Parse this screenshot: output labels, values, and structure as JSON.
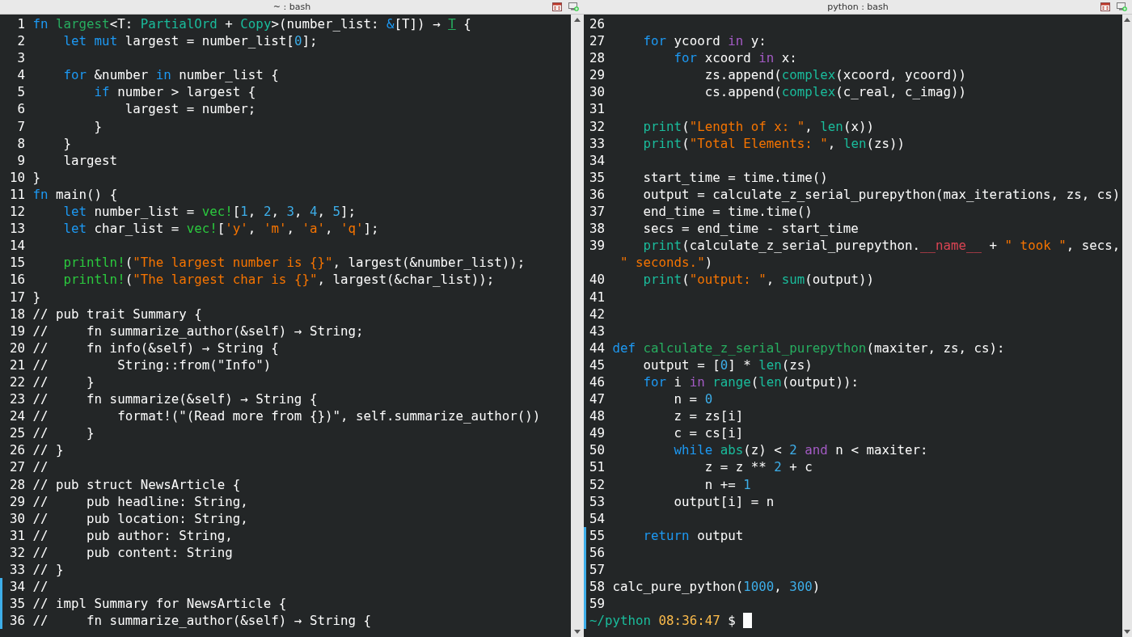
{
  "panes": [
    {
      "title": "~ : bash",
      "lines": [
        {
          "number": "1",
          "marked": false,
          "tokens": [
            {
              "text": "fn",
              "kind": "keyword"
            },
            {
              "text": " largest",
              "kind": "function"
            },
            {
              "text": "<T: ",
              "kind": "plain"
            },
            {
              "text": "PartialOrd",
              "kind": "type"
            },
            {
              "text": " + ",
              "kind": "plain"
            },
            {
              "text": "Copy",
              "kind": "type"
            },
            {
              "text": ">(number_list: ",
              "kind": "plain"
            },
            {
              "text": "&",
              "kind": "keyword"
            },
            {
              "text": "[T]) → ",
              "kind": "plain"
            },
            {
              "text": "T",
              "kind": "return"
            },
            {
              "text": " {",
              "kind": "plain"
            }
          ]
        },
        {
          "number": "2",
          "marked": false,
          "tokens": [
            {
              "text": "    let",
              "kind": "keyword"
            },
            {
              "text": " mut",
              "kind": "keyword"
            },
            {
              "text": " largest = number_list[",
              "kind": "plain"
            },
            {
              "text": "0",
              "kind": "number"
            },
            {
              "text": "];",
              "kind": "plain"
            }
          ]
        },
        {
          "number": "3",
          "marked": false
        },
        {
          "number": "4",
          "marked": false,
          "tokens": [
            {
              "text": "    for",
              "kind": "keyword"
            },
            {
              "text": " &number ",
              "kind": "plain"
            },
            {
              "text": "in",
              "kind": "keyword"
            },
            {
              "text": " number_list {",
              "kind": "plain"
            }
          ]
        },
        {
          "number": "5",
          "marked": false,
          "tokens": [
            {
              "text": "        if",
              "kind": "keyword"
            },
            {
              "text": " number > largest {",
              "kind": "plain"
            }
          ]
        },
        {
          "number": "6",
          "marked": false,
          "tokens": [
            {
              "text": "            largest = number;",
              "kind": "plain"
            }
          ]
        },
        {
          "number": "7",
          "marked": false,
          "tokens": [
            {
              "text": "        }",
              "kind": "plain"
            }
          ]
        },
        {
          "number": "8",
          "marked": false,
          "tokens": [
            {
              "text": "    }",
              "kind": "plain"
            }
          ]
        },
        {
          "number": "9",
          "marked": false,
          "tokens": [
            {
              "text": "    largest",
              "kind": "plain"
            }
          ]
        },
        {
          "number": "10",
          "marked": false,
          "tokens": [
            {
              "text": "}",
              "kind": "plain"
            }
          ]
        },
        {
          "number": "11",
          "marked": false,
          "tokens": [
            {
              "text": "fn",
              "kind": "keyword"
            },
            {
              "text": " main() {",
              "kind": "plain"
            }
          ]
        },
        {
          "number": "12",
          "marked": false,
          "tokens": [
            {
              "text": "    let",
              "kind": "keyword"
            },
            {
              "text": " number_list = ",
              "kind": "plain"
            },
            {
              "text": "vec!",
              "kind": "macro"
            },
            {
              "text": "[",
              "kind": "plain"
            },
            {
              "text": "1",
              "kind": "number"
            },
            {
              "text": ", ",
              "kind": "plain"
            },
            {
              "text": "2",
              "kind": "number"
            },
            {
              "text": ", ",
              "kind": "plain"
            },
            {
              "text": "3",
              "kind": "number"
            },
            {
              "text": ", ",
              "kind": "plain"
            },
            {
              "text": "4",
              "kind": "number"
            },
            {
              "text": ", ",
              "kind": "plain"
            },
            {
              "text": "5",
              "kind": "number"
            },
            {
              "text": "];",
              "kind": "plain"
            }
          ]
        },
        {
          "number": "13",
          "marked": false,
          "tokens": [
            {
              "text": "    let",
              "kind": "keyword"
            },
            {
              "text": " char_list = ",
              "kind": "plain"
            },
            {
              "text": "vec!",
              "kind": "macro"
            },
            {
              "text": "[",
              "kind": "plain"
            },
            {
              "text": "'y'",
              "kind": "string"
            },
            {
              "text": ", ",
              "kind": "plain"
            },
            {
              "text": "'m'",
              "kind": "string"
            },
            {
              "text": ", ",
              "kind": "plain"
            },
            {
              "text": "'a'",
              "kind": "string"
            },
            {
              "text": ", ",
              "kind": "plain"
            },
            {
              "text": "'q'",
              "kind": "string"
            },
            {
              "text": "];",
              "kind": "plain"
            }
          ]
        },
        {
          "number": "14",
          "marked": false
        },
        {
          "number": "15",
          "marked": false,
          "tokens": [
            {
              "text": "    println!",
              "kind": "macro"
            },
            {
              "text": "(",
              "kind": "plain"
            },
            {
              "text": "\"The largest number is {}\"",
              "kind": "string"
            },
            {
              "text": ", largest(&number_list));",
              "kind": "plain"
            }
          ]
        },
        {
          "number": "16",
          "marked": false,
          "tokens": [
            {
              "text": "    println!",
              "kind": "macro"
            },
            {
              "text": "(",
              "kind": "plain"
            },
            {
              "text": "\"The largest char is {}\"",
              "kind": "string"
            },
            {
              "text": ", largest(&char_list));",
              "kind": "plain"
            }
          ]
        },
        {
          "number": "17",
          "marked": false,
          "tokens": [
            {
              "text": "}",
              "kind": "plain"
            }
          ]
        },
        {
          "number": "18",
          "marked": false,
          "tokens": [
            {
              "text": "// pub trait Summary {",
              "kind": "plain"
            }
          ]
        },
        {
          "number": "19",
          "marked": false,
          "tokens": [
            {
              "text": "//     fn summarize_author(&self) → String;",
              "kind": "plain"
            }
          ]
        },
        {
          "number": "20",
          "marked": false,
          "tokens": [
            {
              "text": "//     fn info(&self) → String {",
              "kind": "plain"
            }
          ]
        },
        {
          "number": "21",
          "marked": false,
          "tokens": [
            {
              "text": "//         String::from(\"Info\")",
              "kind": "plain"
            }
          ]
        },
        {
          "number": "22",
          "marked": false,
          "tokens": [
            {
              "text": "//     }",
              "kind": "plain"
            }
          ]
        },
        {
          "number": "23",
          "marked": false,
          "tokens": [
            {
              "text": "//     fn summarize(&self) → String {",
              "kind": "plain"
            }
          ]
        },
        {
          "number": "24",
          "marked": false,
          "tokens": [
            {
              "text": "//         format!(\"(Read more from {})\", self.summarize_author())",
              "kind": "plain"
            }
          ]
        },
        {
          "number": "25",
          "marked": false,
          "tokens": [
            {
              "text": "//     }",
              "kind": "plain"
            }
          ]
        },
        {
          "number": "26",
          "marked": false,
          "tokens": [
            {
              "text": "// }",
              "kind": "plain"
            }
          ]
        },
        {
          "number": "27",
          "marked": false,
          "tokens": [
            {
              "text": "//",
              "kind": "plain"
            }
          ]
        },
        {
          "number": "28",
          "marked": false,
          "tokens": [
            {
              "text": "// pub struct NewsArticle {",
              "kind": "plain"
            }
          ]
        },
        {
          "number": "29",
          "marked": false,
          "tokens": [
            {
              "text": "//     pub headline: String,",
              "kind": "plain"
            }
          ]
        },
        {
          "number": "30",
          "marked": false,
          "tokens": [
            {
              "text": "//     pub location: String,",
              "kind": "plain"
            }
          ]
        },
        {
          "number": "31",
          "marked": false,
          "tokens": [
            {
              "text": "//     pub author: String,",
              "kind": "plain"
            }
          ]
        },
        {
          "number": "32",
          "marked": false,
          "tokens": [
            {
              "text": "//     pub content: String",
              "kind": "plain"
            }
          ]
        },
        {
          "number": "33",
          "marked": false,
          "tokens": [
            {
              "text": "// }",
              "kind": "plain"
            }
          ]
        },
        {
          "number": "34",
          "marked": true,
          "tokens": [
            {
              "text": "//",
              "kind": "plain"
            }
          ]
        },
        {
          "number": "35",
          "marked": true,
          "tokens": [
            {
              "text": "// impl Summary for NewsArticle {",
              "kind": "plain"
            }
          ]
        },
        {
          "number": "36",
          "marked": true,
          "tokens": [
            {
              "text": "//     fn summarize_author(&self) → String {",
              "kind": "plain"
            }
          ]
        }
      ]
    },
    {
      "title": "python : bash",
      "lines": [
        {
          "number": "26",
          "marked": false
        },
        {
          "number": "27",
          "marked": false,
          "tokens": [
            {
              "text": "    for",
              "kind": "keyword"
            },
            {
              "text": " ycoord ",
              "kind": "plain"
            },
            {
              "text": "in",
              "kind": "control"
            },
            {
              "text": " y:",
              "kind": "plain"
            }
          ]
        },
        {
          "number": "28",
          "marked": false,
          "tokens": [
            {
              "text": "        for",
              "kind": "keyword"
            },
            {
              "text": " xcoord ",
              "kind": "plain"
            },
            {
              "text": "in",
              "kind": "control"
            },
            {
              "text": " x:",
              "kind": "plain"
            }
          ]
        },
        {
          "number": "29",
          "marked": false,
          "tokens": [
            {
              "text": "            zs.append(",
              "kind": "plain"
            },
            {
              "text": "complex",
              "kind": "builtin"
            },
            {
              "text": "(xcoord, ycoord))",
              "kind": "plain"
            }
          ]
        },
        {
          "number": "30",
          "marked": false,
          "tokens": [
            {
              "text": "            cs.append(",
              "kind": "plain"
            },
            {
              "text": "complex",
              "kind": "builtin"
            },
            {
              "text": "(c_real, c_imag))",
              "kind": "plain"
            }
          ]
        },
        {
          "number": "31",
          "marked": false
        },
        {
          "number": "32",
          "marked": false,
          "tokens": [
            {
              "text": "    print",
              "kind": "builtin"
            },
            {
              "text": "(",
              "kind": "plain"
            },
            {
              "text": "\"Length of x: \"",
              "kind": "string"
            },
            {
              "text": ", ",
              "kind": "plain"
            },
            {
              "text": "len",
              "kind": "builtin"
            },
            {
              "text": "(x))",
              "kind": "plain"
            }
          ]
        },
        {
          "number": "33",
          "marked": false,
          "tokens": [
            {
              "text": "    print",
              "kind": "builtin"
            },
            {
              "text": "(",
              "kind": "plain"
            },
            {
              "text": "\"Total Elements: \"",
              "kind": "string"
            },
            {
              "text": ", ",
              "kind": "plain"
            },
            {
              "text": "len",
              "kind": "builtin"
            },
            {
              "text": "(zs))",
              "kind": "plain"
            }
          ]
        },
        {
          "number": "34",
          "marked": false
        },
        {
          "number": "35",
          "marked": false,
          "tokens": [
            {
              "text": "    start_time = time.time()",
              "kind": "plain"
            }
          ]
        },
        {
          "number": "36",
          "marked": false,
          "tokens": [
            {
              "text": "    output = calculate_z_serial_purepython(max_iterations, zs, cs)",
              "kind": "plain"
            }
          ]
        },
        {
          "number": "37",
          "marked": false,
          "tokens": [
            {
              "text": "    end_time = time.time()",
              "kind": "plain"
            }
          ]
        },
        {
          "number": "38",
          "marked": false,
          "tokens": [
            {
              "text": "    secs = end_time - start_time",
              "kind": "plain"
            }
          ]
        },
        {
          "number": "39",
          "marked": false,
          "tokens": [
            {
              "text": "    print",
              "kind": "builtin"
            },
            {
              "text": "(calculate_z_serial_purepython.",
              "kind": "plain"
            },
            {
              "text": "__name__",
              "kind": "special"
            },
            {
              "text": " + ",
              "kind": "plain"
            },
            {
              "text": "\" took \"",
              "kind": "string"
            },
            {
              "text": ", secs,",
              "kind": "plain"
            }
          ]
        },
        {
          "marked": false,
          "tokens": [
            {
              "text": " \" seconds.\"",
              "kind": "string"
            },
            {
              "text": ")",
              "kind": "plain"
            }
          ]
        },
        {
          "number": "40",
          "marked": false,
          "tokens": [
            {
              "text": "    print",
              "kind": "builtin"
            },
            {
              "text": "(",
              "kind": "plain"
            },
            {
              "text": "\"output: \"",
              "kind": "string"
            },
            {
              "text": ", ",
              "kind": "plain"
            },
            {
              "text": "sum",
              "kind": "builtin"
            },
            {
              "text": "(output))",
              "kind": "plain"
            }
          ]
        },
        {
          "number": "41",
          "marked": false
        },
        {
          "number": "42",
          "marked": false
        },
        {
          "number": "43",
          "marked": false
        },
        {
          "number": "44",
          "marked": false,
          "tokens": [
            {
              "text": "def",
              "kind": "keyword"
            },
            {
              "text": " calculate_z_serial_purepython",
              "kind": "function"
            },
            {
              "text": "(maxiter, zs, cs):",
              "kind": "plain"
            }
          ]
        },
        {
          "number": "45",
          "marked": false,
          "tokens": [
            {
              "text": "    output = [",
              "kind": "plain"
            },
            {
              "text": "0",
              "kind": "number"
            },
            {
              "text": "] * ",
              "kind": "plain"
            },
            {
              "text": "len",
              "kind": "builtin"
            },
            {
              "text": "(zs)",
              "kind": "plain"
            }
          ]
        },
        {
          "number": "46",
          "marked": false,
          "tokens": [
            {
              "text": "    for",
              "kind": "keyword"
            },
            {
              "text": " i ",
              "kind": "plain"
            },
            {
              "text": "in",
              "kind": "control"
            },
            {
              "text": " range",
              "kind": "builtin"
            },
            {
              "text": "(",
              "kind": "plain"
            },
            {
              "text": "len",
              "kind": "builtin"
            },
            {
              "text": "(output)):",
              "kind": "plain"
            }
          ]
        },
        {
          "number": "47",
          "marked": false,
          "tokens": [
            {
              "text": "        n = ",
              "kind": "plain"
            },
            {
              "text": "0",
              "kind": "number"
            }
          ]
        },
        {
          "number": "48",
          "marked": false,
          "tokens": [
            {
              "text": "        z = zs[i]",
              "kind": "plain"
            }
          ]
        },
        {
          "number": "49",
          "marked": false,
          "tokens": [
            {
              "text": "        c = cs[i]",
              "kind": "plain"
            }
          ]
        },
        {
          "number": "50",
          "marked": false,
          "tokens": [
            {
              "text": "        while",
              "kind": "keyword"
            },
            {
              "text": " abs",
              "kind": "builtin"
            },
            {
              "text": "(z) < ",
              "kind": "plain"
            },
            {
              "text": "2",
              "kind": "number"
            },
            {
              "text": " and",
              "kind": "control"
            },
            {
              "text": " n < maxiter:",
              "kind": "plain"
            }
          ]
        },
        {
          "number": "51",
          "marked": false,
          "tokens": [
            {
              "text": "            z = z ** ",
              "kind": "plain"
            },
            {
              "text": "2",
              "kind": "number"
            },
            {
              "text": " + c",
              "kind": "plain"
            }
          ]
        },
        {
          "number": "52",
          "marked": false,
          "tokens": [
            {
              "text": "            n += ",
              "kind": "plain"
            },
            {
              "text": "1",
              "kind": "number"
            }
          ]
        },
        {
          "number": "53",
          "marked": false,
          "tokens": [
            {
              "text": "        output[i] = n",
              "kind": "plain"
            }
          ]
        },
        {
          "number": "54",
          "marked": false
        },
        {
          "number": "55",
          "marked": true,
          "tokens": [
            {
              "text": "    return",
              "kind": "keyword"
            },
            {
              "text": " output",
              "kind": "plain"
            }
          ]
        },
        {
          "number": "56",
          "marked": true
        },
        {
          "number": "57",
          "marked": true
        },
        {
          "number": "58",
          "marked": true,
          "tokens": [
            {
              "text": "calc_pure_python(",
              "kind": "plain"
            },
            {
              "text": "1000",
              "kind": "number"
            },
            {
              "text": ", ",
              "kind": "plain"
            },
            {
              "text": "300",
              "kind": "number"
            },
            {
              "text": ")",
              "kind": "plain"
            }
          ]
        },
        {
          "number": "59",
          "marked": true
        }
      ],
      "prompt": {
        "path": "~/python",
        "time": "08:36:47",
        "symbol": "$",
        "cursor": true,
        "marked": true
      }
    }
  ]
}
